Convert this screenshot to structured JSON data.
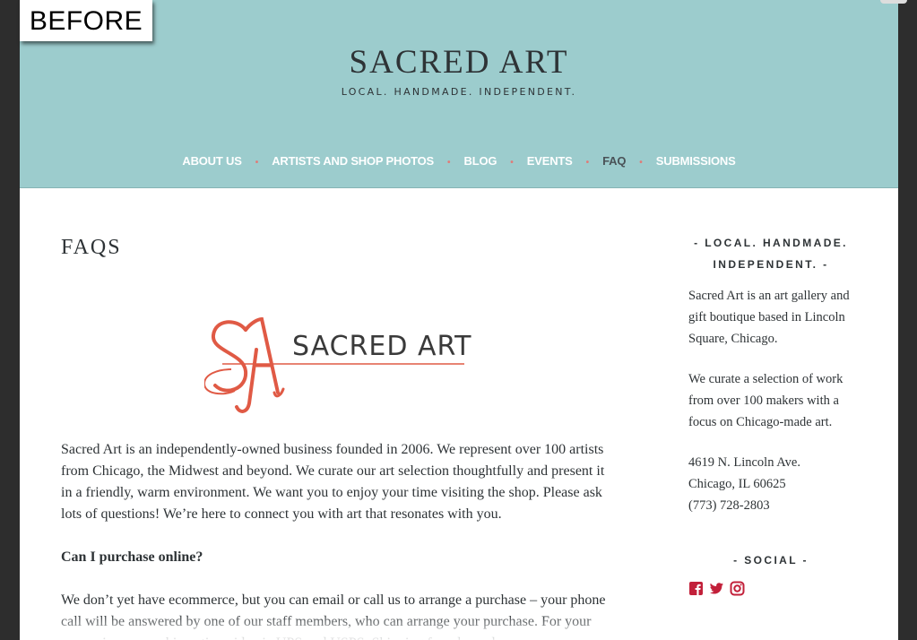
{
  "badge": "BEFORE",
  "site": {
    "title": "SACRED ART",
    "tagline": "LOCAL. HANDMADE. INDEPENDENT."
  },
  "nav": {
    "items": [
      "ABOUT US",
      "ARTISTS AND SHOP PHOTOS",
      "BLOG",
      "EVENTS",
      "FAQ",
      "SUBMISSIONS"
    ],
    "active": "FAQ",
    "separator": "•"
  },
  "main": {
    "heading": "FAQS",
    "logo_text": "SACRED ART",
    "intro": "Sacred Art is an independently-owned business founded in 2006. We represent over 100 artists from Chicago, the Midwest and beyond. We curate our art selection thoughtfully and present it in a friendly, warm environment. We want you to enjoy your time visiting the shop. Please ask lots of questions! We’re here to connect you with art that resonates with you.",
    "question_1": "Can I purchase online?",
    "answer_1": "We don’t yet have ecommerce, but you can email or call us to arrange a purchase – your phone call will be answered by one of our staff members, who can arrange your purchase. For your convenience, we ship nationwide via UPS and USPS. Shipping fees depend"
  },
  "sidebar": {
    "widget_title": "- LOCAL. HANDMADE. INDEPENDENT. -",
    "about": "Sacred Art is an art gallery and gift boutique based in Lincoln Square, Chicago.",
    "curate": "We curate a selection of work from over 100 makers with a focus on Chicago-made art.",
    "address_line1": "4619 N. Lincoln Ave.",
    "address_line2": "Chicago, IL 60625",
    "phone": "(773) 728-2803",
    "social_title": "- SOCIAL -",
    "social_icons": [
      "facebook-icon",
      "twitter-icon",
      "instagram-icon"
    ]
  },
  "colors": {
    "header_bg": "#9ccccd",
    "accent": "#e05a45",
    "text": "#2e3336",
    "nav_separator": "#e07b78",
    "social_icon": "#c2203a"
  }
}
